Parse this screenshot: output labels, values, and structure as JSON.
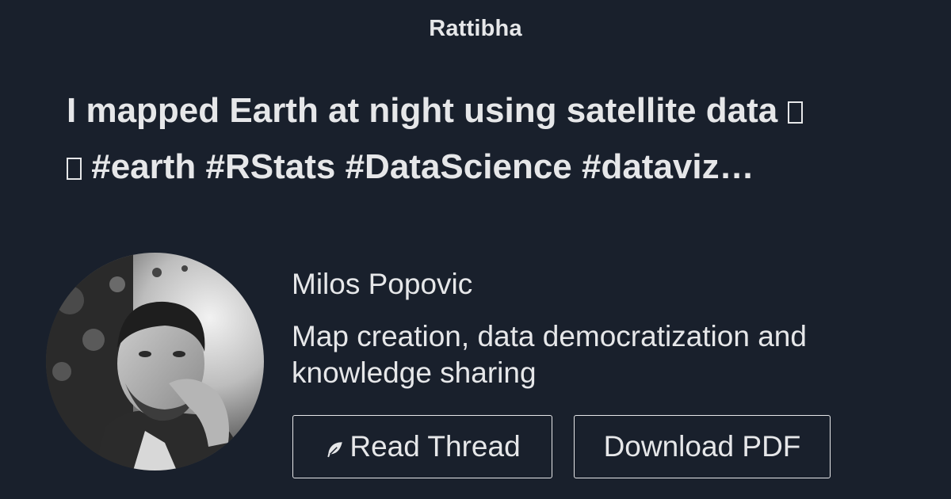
{
  "site": {
    "brand": "Rattibha"
  },
  "thread": {
    "title_line1": "I mapped Earth at night using satellite data",
    "title_line2": "#earth #RStats #DataScience #dataviz…"
  },
  "author": {
    "name": "Milos Popovic",
    "bio": "Map creation, data democratization and knowledge sharing"
  },
  "actions": {
    "read_label": "Read Thread",
    "download_label": "Download PDF"
  },
  "icons": {
    "read": "feather-icon",
    "unsupported_glyph": "missing-glyph-box"
  },
  "colors": {
    "background": "#19202c",
    "text": "#e6e7e9"
  }
}
